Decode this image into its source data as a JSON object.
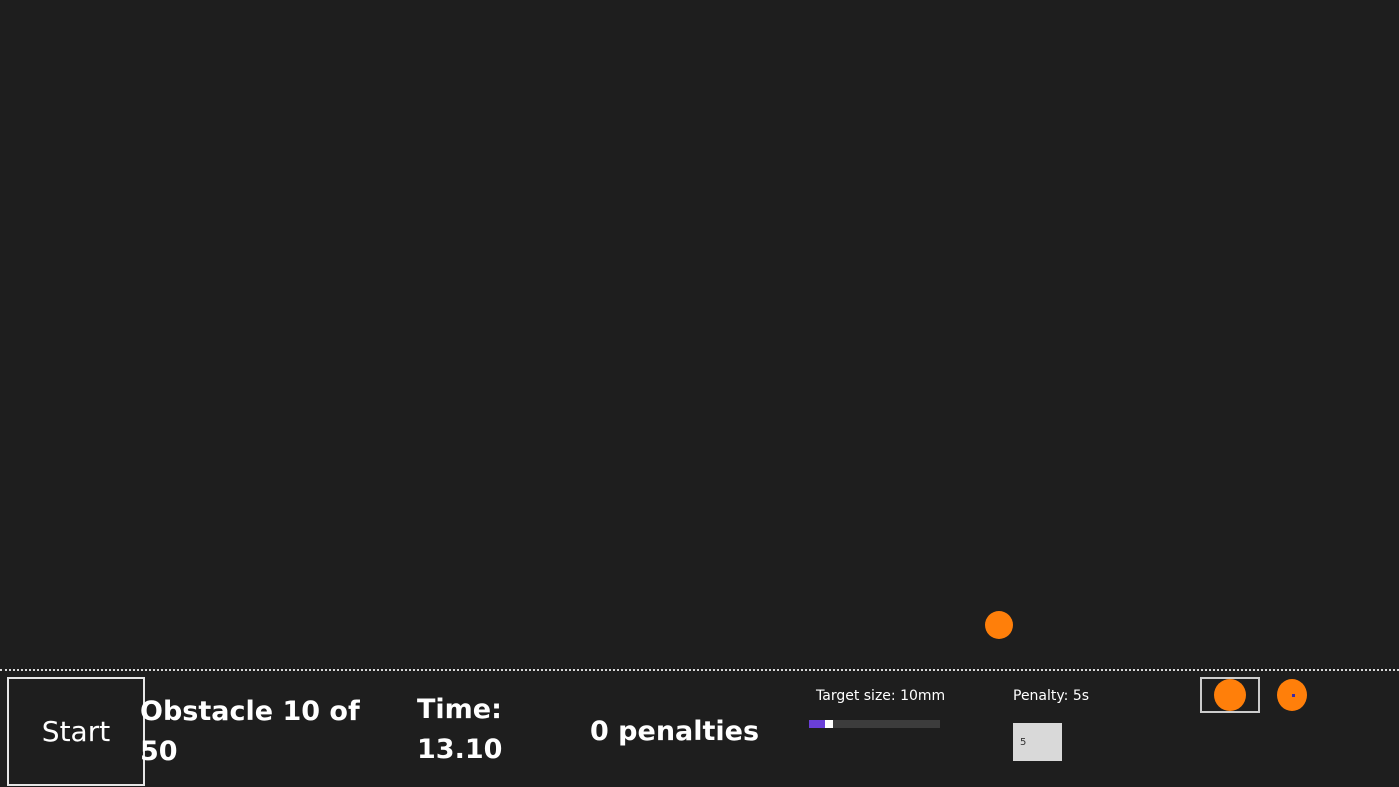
{
  "controls": {
    "start_label": "Start"
  },
  "status": {
    "obstacle_text": "Obstacle 10 of 50",
    "time_text": "Time: 13.10",
    "penalties_text": "0 penalties"
  },
  "settings": {
    "target_size_label": "Target size: 10mm",
    "target_size_slider_fraction": 0.13,
    "penalty_label": "Penalty: 5s",
    "penalty_value": "5"
  },
  "modes": {
    "mode_1_icon": "large-circle-icon",
    "mode_2_icon": "circle-with-center-dot-icon"
  },
  "colors": {
    "background": "#1e1e1e",
    "accent_orange": "#ff7f0a",
    "slider_fill": "#6a3fd8"
  }
}
